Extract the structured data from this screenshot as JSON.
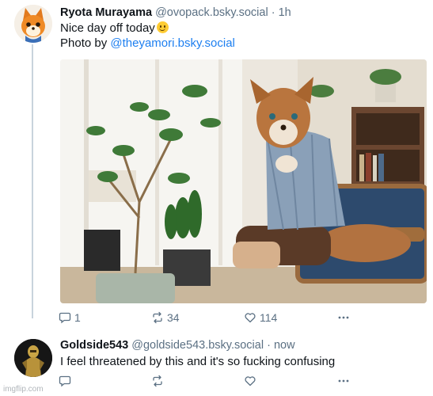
{
  "post": {
    "display_name": "Ryota Murayama",
    "handle": "@ovopack.bsky.social",
    "separator": "·",
    "time": "1h",
    "line1": "Nice day off today",
    "photo_by_label": "Photo by ",
    "photo_by_mention": "@theyamori.bsky.social",
    "image_description": "Furry fox-like character in a checked shirt sitting in a wooden armchair beside potted plants in a bright room",
    "reply_count": "1",
    "repost_count": "34",
    "like_count": "114"
  },
  "reply": {
    "display_name": "Goldside543",
    "handle": "@goldside543.bsky.social",
    "separator": "·",
    "time": "now",
    "text": "I feel threatened by this and it's so fucking confusing"
  },
  "watermark": "imgflip.com",
  "icons": {
    "reply": "speech-bubble-icon",
    "repost": "repost-arrows-icon",
    "like": "heart-icon",
    "more": "ellipsis-icon",
    "emoji": "smiling-face-emoji"
  },
  "colors": {
    "link": "#1d7ff0",
    "muted": "#5b7083",
    "thread_line": "#c8d3dc"
  }
}
